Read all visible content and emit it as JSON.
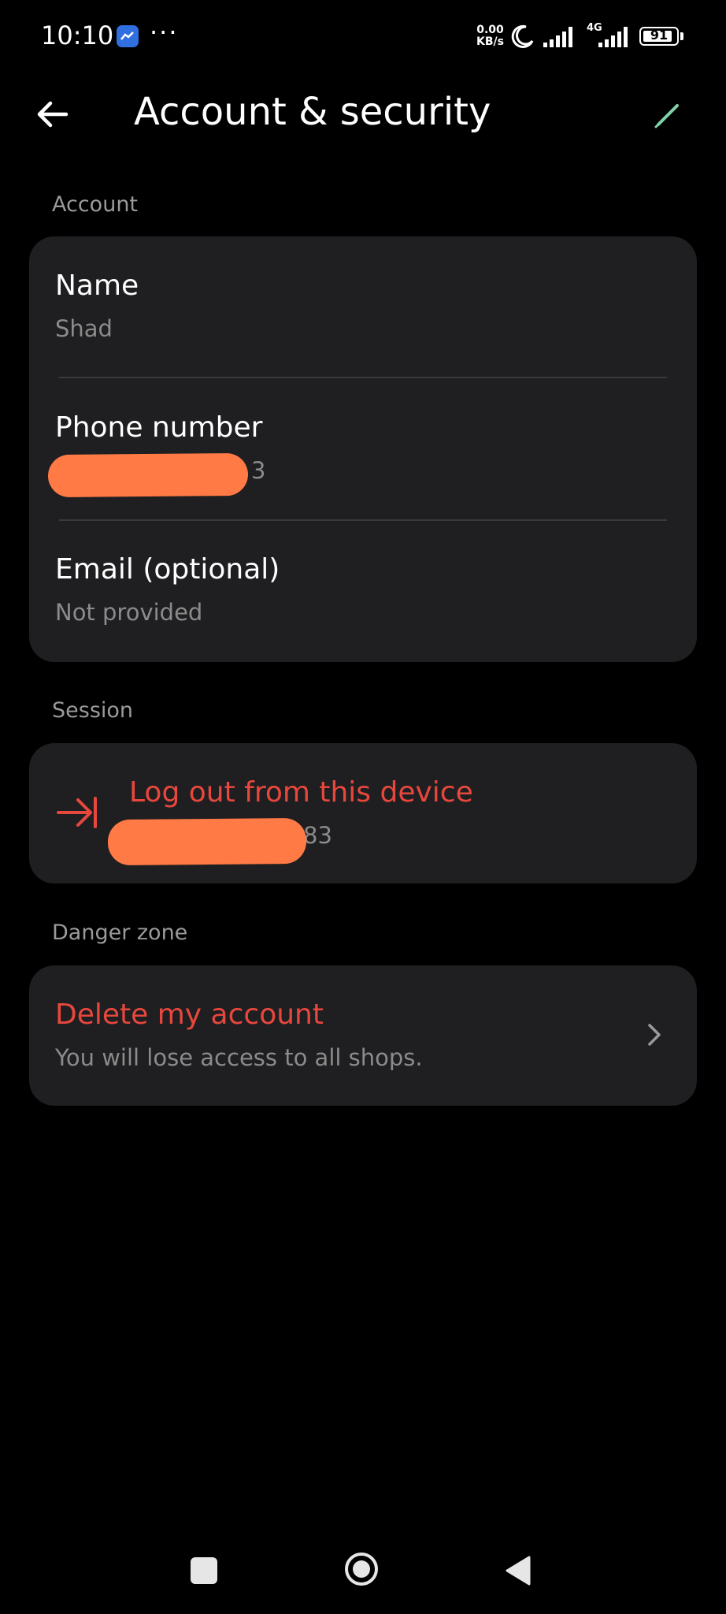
{
  "status_bar": {
    "time": "10:10",
    "speed_value": "0.00",
    "speed_unit": "KB/s",
    "network": "4G",
    "battery": "91",
    "battery_level": 0.91
  },
  "header": {
    "title": "Account & security",
    "back_icon": "arrow-left-icon",
    "edit_icon": "pencil-icon"
  },
  "account": {
    "label": "Account",
    "name_title": "Name",
    "name_value": "Shad",
    "phone_title": "Phone number",
    "phone_value_visible": "3",
    "email_title": "Email (optional)",
    "email_value": "Not provided"
  },
  "session": {
    "label": "Session",
    "logout_title": "Log out from this device",
    "logout_value_visible": "83",
    "logout_icon": "logout-icon"
  },
  "danger": {
    "label": "Danger zone",
    "delete_title": "Delete my account",
    "delete_subtitle": "You will lose access to all shops.",
    "chevron_icon": "chevron-right-icon"
  },
  "colors": {
    "background": "#000000",
    "card": "#1f1f21",
    "danger_red": "#e8473d",
    "redaction": "#ff7a45",
    "edit_accent": "#7fd3a8"
  }
}
